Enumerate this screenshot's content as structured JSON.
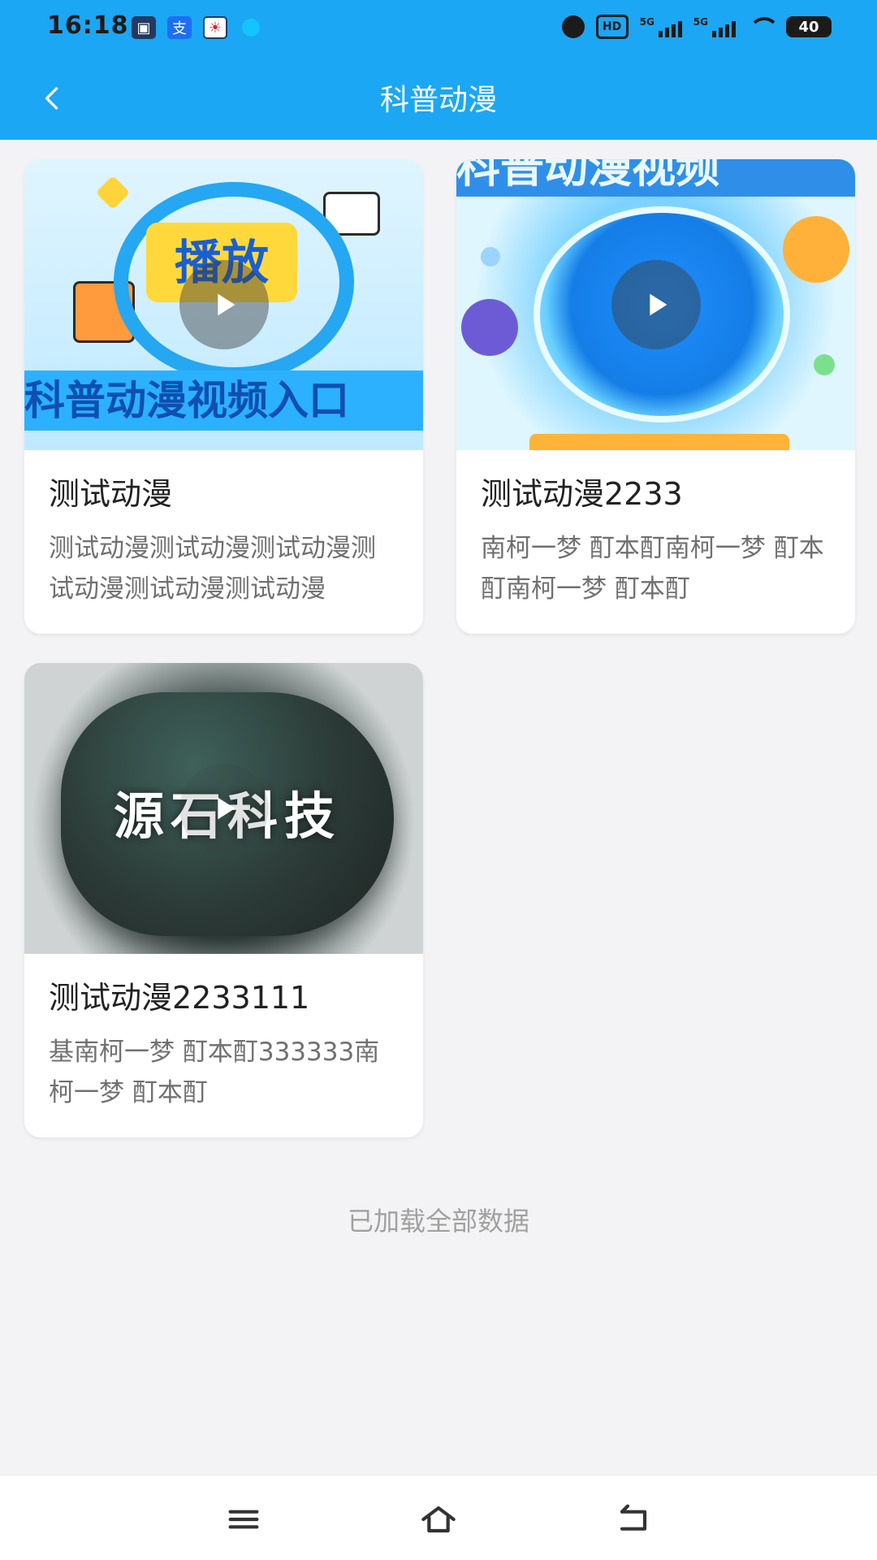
{
  "status_bar": {
    "time": "16:18",
    "battery_level": "40",
    "network_labels": [
      "5G",
      "5G"
    ],
    "hd_label": "HD"
  },
  "app_bar": {
    "title": "科普动漫"
  },
  "cards": [
    {
      "title": "测试动漫",
      "description": "测试动漫测试动漫测试动漫测试动漫测试动漫测试动漫",
      "thumb_text_badge": "播放",
      "thumb_text_banner": "科普动漫视频入口"
    },
    {
      "title": "测试动漫2233",
      "description": "南柯一梦 酊本酊南柯一梦 酊本酊南柯一梦 酊本酊",
      "thumb_text_banner": "科普动漫视频"
    },
    {
      "title": "测试动漫2233111",
      "description": "基南柯一梦 酊本酊333333南柯一梦 酊本酊",
      "thumb_text_logo": "源石科技"
    }
  ],
  "footer": {
    "loaded_all_text": "已加载全部数据"
  },
  "colors": {
    "primary": "#1ba7f3",
    "background": "#f3f3f5",
    "card_bg": "#ffffff",
    "title_text": "#222222",
    "desc_text": "#707070",
    "footer_text": "#a0a0a0"
  },
  "icons": {
    "back": "back-chevron-icon",
    "play": "play-icon",
    "nav_menu": "menu-icon",
    "nav_home": "home-icon",
    "nav_back": "back-icon"
  }
}
